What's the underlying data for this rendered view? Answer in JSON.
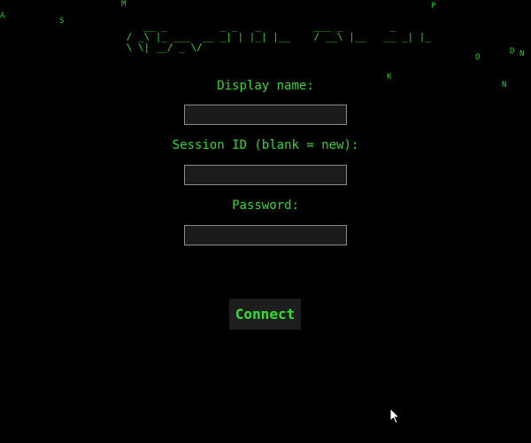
{
  "rain_glyphs": [
    "M",
    "P",
    "A",
    "S",
    "D",
    "N",
    "O",
    "K",
    "N"
  ],
  "banner_ascii": "    __ _         _ _   _         ___ _        _\n / _\\ |_ ___  __ _| | |_| |__    / __\\ |__   __ _| |_\n \\ \\| __/ _ \\/",
  "form": {
    "display_name_label": "Display name:",
    "display_name_value": "",
    "session_id_label": "Session ID (blank = new):",
    "session_id_value": "",
    "password_label": "Password:",
    "password_value": ""
  },
  "connect_label": "Connect",
  "colors": {
    "background": "#000000",
    "text_green": "#33d633",
    "field_bg": "#1b1b1b",
    "field_border": "#8a8a8a",
    "button_bg": "#1e1e1e"
  },
  "icons": [
    "mouse-pointer-icon"
  ]
}
